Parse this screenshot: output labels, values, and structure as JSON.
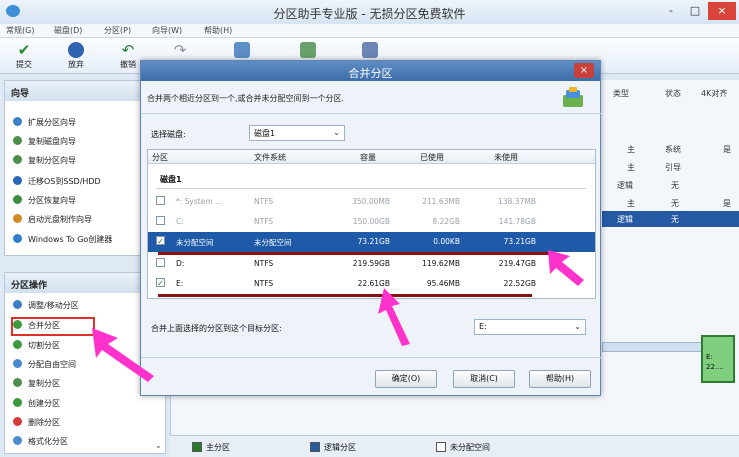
{
  "window": {
    "title": "分区助手专业版 - 无损分区免费软件",
    "minimize": "-",
    "maximize": "□",
    "close": "×"
  },
  "menu": [
    "常规(G)",
    "磁盘(D)",
    "分区(P)",
    "向导(W)",
    "帮助(H)"
  ],
  "toolbar": [
    {
      "label": "提交",
      "icon": "check-icon"
    },
    {
      "label": "放弃",
      "icon": "discard-icon"
    },
    {
      "label": "撤销",
      "icon": "undo-icon"
    },
    {
      "label": "",
      "icon": "redo-icon"
    },
    {
      "label": "",
      "icon": "refresh-icon"
    },
    {
      "label": "",
      "icon": "home-icon"
    },
    {
      "label": "",
      "icon": "disk-icon"
    }
  ],
  "wizard": {
    "title": "向导",
    "items": [
      "扩展分区向导",
      "复制磁盘向导",
      "复制分区向导",
      "迁移OS到SSD/HDD",
      "分区恢复向导",
      "启动光盘制作向导",
      "Windows To Go创建器"
    ]
  },
  "operations": {
    "title": "分区操作",
    "items": [
      "调整/移动分区",
      "合并分区",
      "切割分区",
      "分配自由空间",
      "复制分区",
      "创建分区",
      "删除分区",
      "格式化分区"
    ]
  },
  "right_columns": {
    "type": "类型",
    "status": "状态",
    "other": "4K对齐",
    "rows": [
      {
        "type": "主",
        "status": "系统",
        "other": "是"
      },
      {
        "type": "主",
        "status": "引导",
        "other": ""
      },
      {
        "type": "逻辑",
        "status": "无",
        "other": ""
      },
      {
        "type": "主",
        "status": "无",
        "other": "是"
      },
      {
        "type": "逻辑",
        "status": "无",
        "other": ""
      }
    ]
  },
  "mini_disk": {
    "label1": "E:",
    "label2": "22...."
  },
  "dialog": {
    "title": "合并分区",
    "close": "×",
    "description": "合并两个相近分区到一个,或合并未分配空间到一个分区.",
    "select_disk_label": "选择磁盘:",
    "select_disk_value": "磁盘1",
    "columns": {
      "partition": "分区",
      "fs": "文件系统",
      "capacity": "容量",
      "used": "已使用",
      "free": "未使用"
    },
    "group": "磁盘1",
    "rows": [
      {
        "name": "*: System ...",
        "fs": "NTFS",
        "capacity": "350.00MB",
        "used": "211.63MB",
        "free": "138.37MB",
        "check": "",
        "state": "dim"
      },
      {
        "name": "C:",
        "fs": "NTFS",
        "capacity": "150.00GB",
        "used": "8.22GB",
        "free": "141.78GB",
        "check": "",
        "state": "dim"
      },
      {
        "name": "未分配空间",
        "fs": "未分配空间",
        "capacity": "73.21GB",
        "used": "0.00KB",
        "free": "73.21GB",
        "check": "✓",
        "state": "selected"
      },
      {
        "name": "D:",
        "fs": "NTFS",
        "capacity": "219.59GB",
        "used": "119.62MB",
        "free": "219.47GB",
        "check": "",
        "state": "normal"
      },
      {
        "name": "E:",
        "fs": "NTFS",
        "capacity": "22.61GB",
        "used": "95.46MB",
        "free": "22.52GB",
        "check": "✓",
        "state": "normal"
      }
    ],
    "target_label": "合并上面选择的分区到这个目标分区:",
    "target_value": "E:",
    "ok": "确定(O)",
    "cancel": "取消(C)",
    "help": "帮助(H)"
  },
  "legend": [
    {
      "label": "主分区",
      "color": "#2a7a2a"
    },
    {
      "label": "逻辑分区",
      "color": "#2c5aa0"
    },
    {
      "label": "未分配空间",
      "color": "#ffffff"
    }
  ],
  "colors": {
    "accent": "#3e6ea9",
    "selected_row": "#1e5aa8",
    "annotation": "#ff33cc",
    "underline": "#8a1111"
  }
}
